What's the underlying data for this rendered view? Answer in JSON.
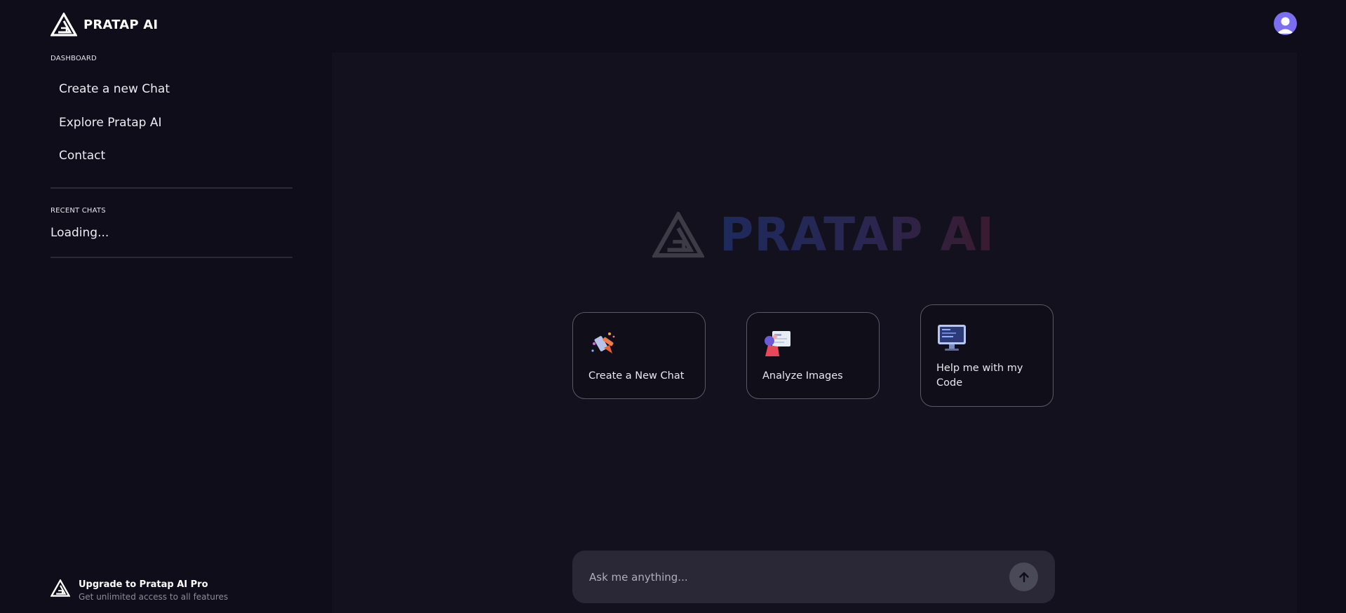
{
  "brand": {
    "name": "PRATAP AI"
  },
  "sidebar": {
    "dashboard_label": "DASHBOARD",
    "nav_items": [
      {
        "label": "Create a new Chat"
      },
      {
        "label": "Explore Pratap AI"
      },
      {
        "label": "Contact"
      }
    ],
    "recent_label": "RECENT CHATS",
    "recent_status": "Loading...",
    "upgrade": {
      "title": "Upgrade to Pratap AI Pro",
      "subtitle": "Get unlimited access to all features"
    }
  },
  "hero": {
    "title": "PRATAP AI"
  },
  "cards": [
    {
      "label": "Create a New Chat",
      "icon": "rocket-chat-icon"
    },
    {
      "label": "Analyze Images",
      "icon": "image-analysis-icon"
    },
    {
      "label": "Help me with my Code",
      "icon": "code-monitor-icon"
    }
  ],
  "input": {
    "placeholder": "Ask me anything..."
  },
  "colors": {
    "background": "#0e0d19",
    "panel": "#12111d",
    "avatar": "#7b6ff0",
    "input_bg": "#2a2837",
    "send_button": "#4a4957"
  }
}
